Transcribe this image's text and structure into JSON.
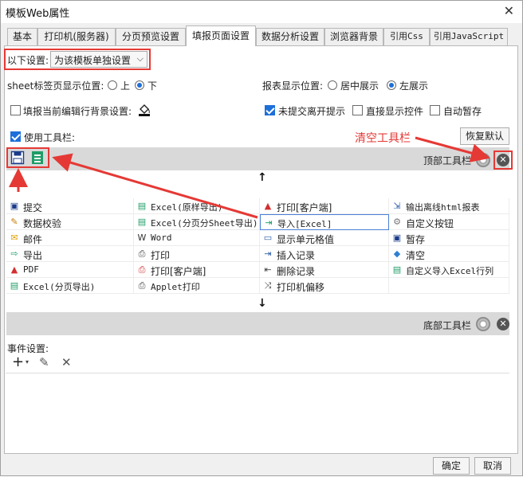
{
  "window": {
    "title": "模板Web属性",
    "close_glyph": "✕"
  },
  "tabs": [
    {
      "label": "基本"
    },
    {
      "label": "打印机(服务器)"
    },
    {
      "label": "分页预览设置"
    },
    {
      "label": "填报页面设置"
    },
    {
      "label": "数据分析设置"
    },
    {
      "label": "浏览器背景"
    },
    {
      "label": "引用Css"
    },
    {
      "label": "引用JavaScript"
    }
  ],
  "settings": {
    "scope_label": "以下设置:",
    "scope_value": "为该模板单独设置",
    "sheet_pos_label": "sheet标签页显示位置:",
    "sheet_pos_up": "上",
    "sheet_pos_down": "下",
    "report_pos_label": "报表显示位置:",
    "report_pos_center": "居中展示",
    "report_pos_left": "左展示",
    "bg_setting_label": "填报当前编辑行背景设置:",
    "unsubmit_label": "未提交离开提示",
    "direct_show_label": "直接显示控件",
    "autosave_label": "自动暂存",
    "use_toolbar_label": "使用工具栏:",
    "restore_default": "恢复默认"
  },
  "annotation": {
    "clear_toolbar": "清空工具栏",
    "color": "#e53935"
  },
  "top_toolbar": {
    "label": "顶部工具栏"
  },
  "bottom_toolbar": {
    "label": "底部工具栏"
  },
  "buttons_grid": [
    [
      "提交",
      "Excel(原样导出)",
      "打印[客户端]",
      "输出离线html报表"
    ],
    [
      "数据校验",
      "Excel(分页分Sheet导出)",
      "导入[Excel]",
      "自定义按钮"
    ],
    [
      "邮件",
      "Word",
      "显示单元格值",
      "暂存"
    ],
    [
      "导出",
      "打印",
      "插入记录",
      "清空"
    ],
    [
      "PDF",
      "打印[客户端]",
      "删除记录",
      "自定义导入Excel行列"
    ],
    [
      "Excel(分页导出)",
      "Applet打印",
      "打印机偏移",
      ""
    ]
  ],
  "events": {
    "label": "事件设置:"
  },
  "footer": {
    "ok": "确定",
    "cancel": "取消"
  }
}
